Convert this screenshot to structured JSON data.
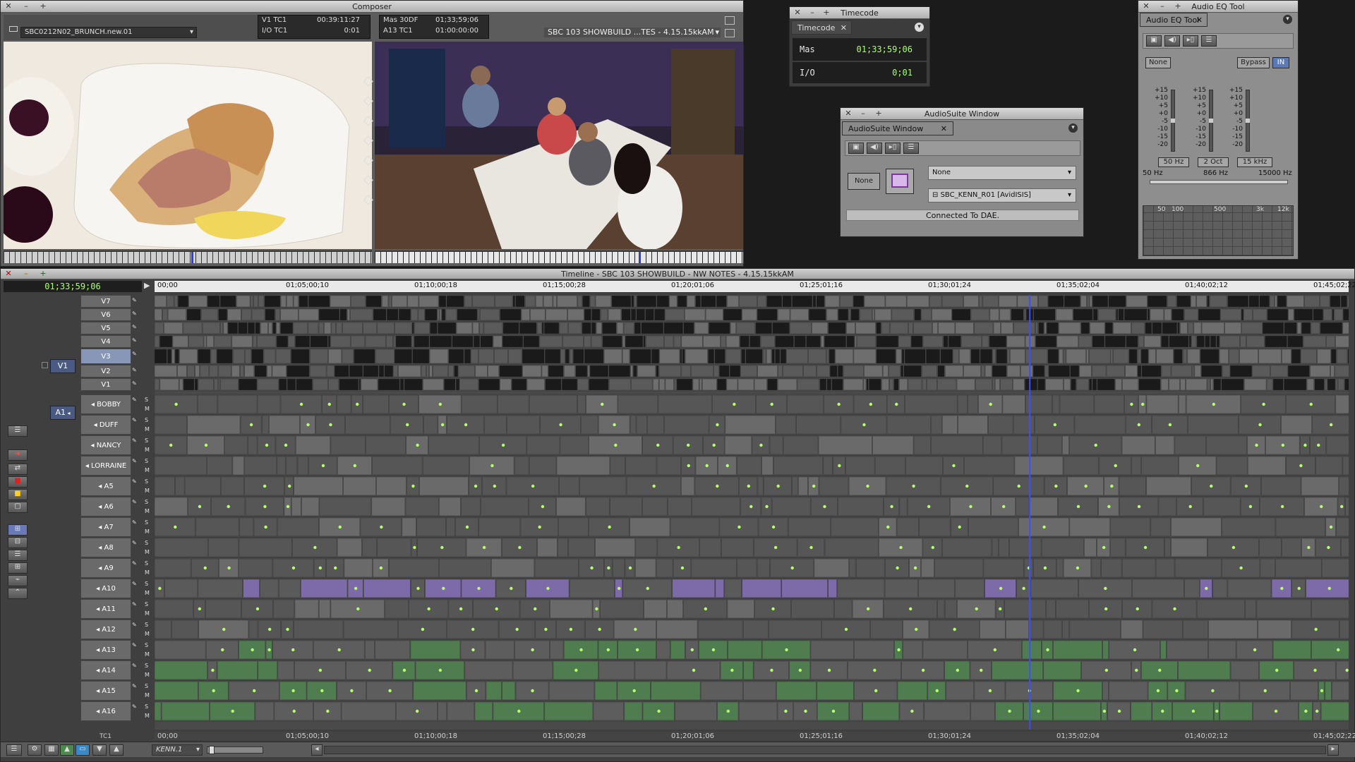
{
  "composer": {
    "title": "Composer",
    "source_clip": "SBC0212N02_BRUNCH.new.01",
    "tc_rows": [
      {
        "label": "V1 TC1",
        "value": "00:39:11:27"
      },
      {
        "label": "I/O TC1",
        "value": "0:01"
      }
    ],
    "rec_rows": [
      {
        "label": "Mas 30DF",
        "value": "01;33;59;06"
      },
      {
        "label": "A13 TC1",
        "value": "01:00:00:00"
      }
    ],
    "record_sequence": "SBC 103 SHOWBUILD ...TES - 4.15.15kkAM"
  },
  "timecode_window": {
    "title": "Timecode",
    "tab": "Timecode",
    "rows": [
      {
        "label": "Mas",
        "value": "01;33;59;06"
      },
      {
        "label": "I/O",
        "value": "0;01"
      }
    ]
  },
  "audiosuite": {
    "title": "AudioSuite Window",
    "tab": "AudioSuite Window",
    "none_button": "None",
    "plugin_select": "None",
    "volume_select": "SBC_KENN_R01 [AvidISIS]",
    "status": "Connected To DAE."
  },
  "eq_tool": {
    "title": "Audio EQ Tool",
    "tab": "Audio EQ Tool",
    "none_button": "None",
    "bypass_button": "Bypass",
    "in_button": "IN",
    "scale": [
      "+15",
      "+10",
      "+5",
      "+0",
      "-5",
      "-10",
      "-15",
      "-20"
    ],
    "band_buttons": [
      "50 Hz",
      "2 Oct",
      "15 kHz"
    ],
    "freq_labels": [
      "50 Hz",
      "866 Hz",
      "15000 Hz"
    ],
    "graph_labels": [
      "50",
      "100",
      "500",
      "3k",
      "12k"
    ],
    "gains": [
      0,
      0,
      0
    ]
  },
  "timeline": {
    "title": "Timeline - SBC 103 SHOWBUILD - NW NOTES - 4.15.15kkAM",
    "current_tc": "01;33;59;06",
    "ruler": [
      "00;00",
      "01;05;00;10",
      "01;10;00;18",
      "01;15;00;28",
      "01;20;01;06",
      "01;25;01;16",
      "01;30;01;24",
      "01;35;02;04",
      "01;40;02;12",
      "01;45;02;22"
    ],
    "bottom_ruler": [
      "00;00",
      "01;05;00;10",
      "01;10;00;18",
      "01;15;00;28",
      "01;20;01;06",
      "01;25;01;16",
      "01;30;01;24",
      "01;35;02;04",
      "01;40;02;12",
      "01;45;02;22"
    ],
    "position_fraction": 0.733,
    "video_tracks": [
      "V7",
      "V6",
      "V5",
      "V4",
      "V3",
      "V2",
      "V1"
    ],
    "audio_tracks": [
      "BOBBY",
      "DUFF",
      "NANCY",
      "LORRAINE",
      "A5",
      "A6",
      "A7",
      "A8",
      "A9",
      "A10",
      "A11",
      "A12",
      "A13",
      "A14",
      "A15",
      "A16"
    ],
    "source_video": "V1",
    "source_audio": "A1",
    "tc_track": "TC1",
    "bin_name": "KENN.1"
  },
  "colors": {
    "video_lane": "#5e5e5e",
    "audio_green": "#4f7d4f",
    "audio_purple": "#7d6aa8",
    "playhead": "#3b4fff",
    "marker": "#b5ff6a"
  }
}
